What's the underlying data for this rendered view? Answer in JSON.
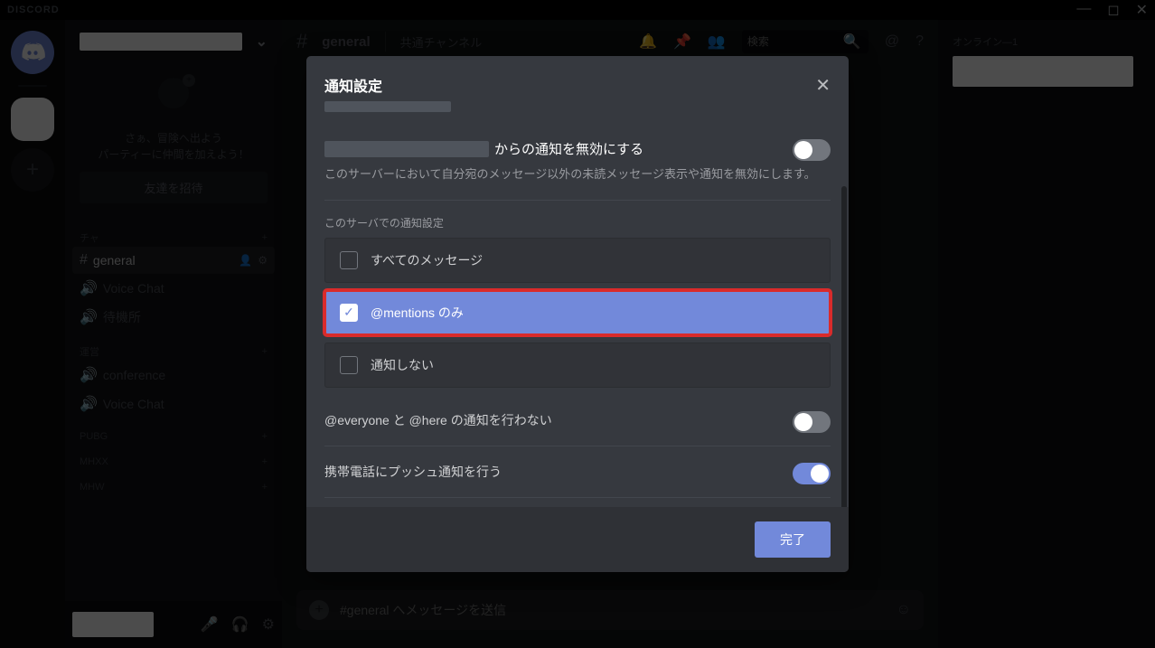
{
  "titlebar": {
    "logo": "DISCORD"
  },
  "sidebar": {
    "invite_line1": "さぁ、冒険へ出よう",
    "invite_line2": "パーティーに仲間を加えよう！",
    "invite_button": "友達を招待",
    "categories": [
      {
        "name": "チャ",
        "channels": [
          {
            "name": "general",
            "icon": "hash",
            "selected": true
          },
          {
            "name": "Voice Chat",
            "icon": "speaker"
          },
          {
            "name": "待機所",
            "icon": "speaker"
          }
        ]
      },
      {
        "name": "運営",
        "channels": [
          {
            "name": "conference",
            "icon": "speaker"
          },
          {
            "name": "Voice Chat",
            "icon": "speaker"
          }
        ]
      },
      {
        "name": "PUBG",
        "channels": []
      },
      {
        "name": "MHXX",
        "channels": []
      },
      {
        "name": "MHW",
        "channels": []
      }
    ]
  },
  "topbar": {
    "channel": "general",
    "subtitle": "共通チャンネル",
    "search_placeholder": "検索"
  },
  "members": {
    "header": "オンライン—1"
  },
  "chat": {
    "placeholder": "#general へメッセージを送信"
  },
  "modal": {
    "title": "通知設定",
    "mute_suffix": "からの通知を無効にする",
    "mute_desc": "このサーバーにおいて自分宛のメッセージ以外の未読メッセージ表示や通知を無効にします。",
    "section_label": "このサーバでの通知設定",
    "options": {
      "all": "すべてのメッセージ",
      "mentions": "@mentions のみ",
      "none": "通知しない"
    },
    "suppress_everyone": "@everyone と @here の通知を行わない",
    "mobile_push": "携帯電話にプッシュ通知を行う",
    "done": "完了"
  }
}
